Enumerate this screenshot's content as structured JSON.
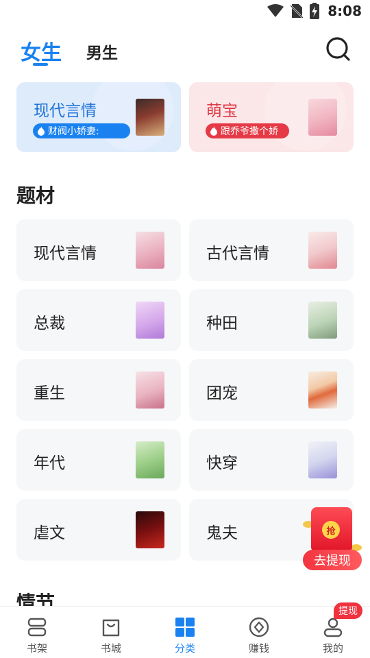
{
  "status_bar": {
    "time": "8:08"
  },
  "header": {
    "tabs": [
      {
        "label": "女生",
        "active": true
      },
      {
        "label": "男生",
        "active": false
      }
    ]
  },
  "features": [
    {
      "title": "现代言情",
      "tag": "财阀小娇妻:",
      "color": "#1a82f0"
    },
    {
      "title": "萌宝",
      "tag": "跟乔爷撒个娇",
      "color": "#e53a46"
    }
  ],
  "sections": {
    "topics_title": "题材",
    "plot_title": "情节"
  },
  "topics": [
    {
      "label": "现代言情"
    },
    {
      "label": "古代言情"
    },
    {
      "label": "总裁"
    },
    {
      "label": "种田"
    },
    {
      "label": "重生"
    },
    {
      "label": "团宠"
    },
    {
      "label": "年代"
    },
    {
      "label": "快穿"
    },
    {
      "label": "虐文"
    },
    {
      "label": "鬼夫"
    }
  ],
  "reward": {
    "coin": "抢",
    "button": "去提现"
  },
  "bottom_nav": {
    "items": [
      {
        "label": "书架",
        "icon": "bookshelf-icon"
      },
      {
        "label": "书城",
        "icon": "bookstore-bag-icon"
      },
      {
        "label": "分类",
        "icon": "category-grid-icon",
        "active": true
      },
      {
        "label": "赚钱",
        "icon": "coin-icon"
      },
      {
        "label": "我的",
        "icon": "profile-icon"
      }
    ],
    "badge": "提现"
  },
  "colors": {
    "accent": "#1a82f0",
    "red": "#e53a46"
  }
}
